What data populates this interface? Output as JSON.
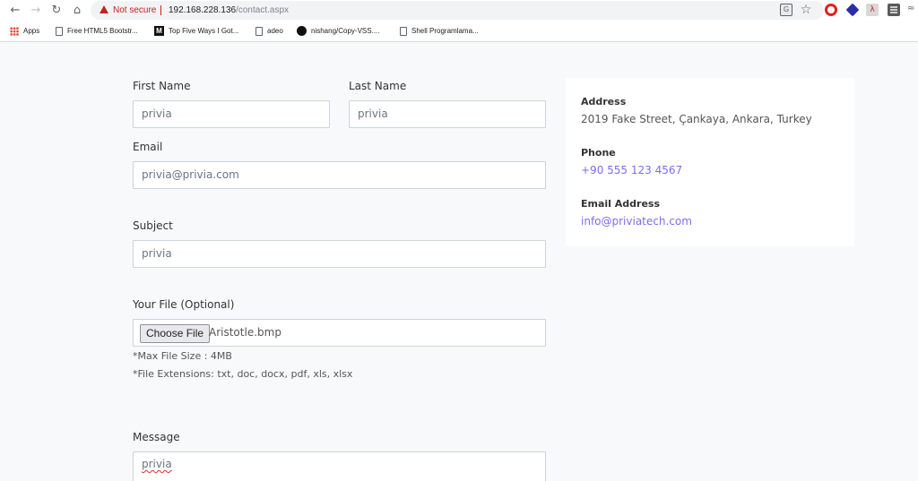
{
  "browser": {
    "security_label": "Not secure",
    "url_host": "192.168.228.136",
    "url_path": "/contact.aspx",
    "bookmarks": [
      {
        "label": "Apps"
      },
      {
        "label": "Free HTML5 Bootstr..."
      },
      {
        "label": "Top Five Ways I Got..."
      },
      {
        "label": "adeo"
      },
      {
        "label": "nishang/Copy-VSS...."
      },
      {
        "label": "Shell Programlama..."
      }
    ]
  },
  "form": {
    "first_name": {
      "label": "First Name",
      "value": "privia"
    },
    "last_name": {
      "label": "Last Name",
      "value": "privia"
    },
    "email": {
      "label": "Email",
      "value": "privia@privia.com"
    },
    "subject": {
      "label": "Subject",
      "value": "privia"
    },
    "file": {
      "label": "Your File (Optional)",
      "button": "Choose File",
      "file_name": "Aristotle.bmp",
      "max_size": "*Max File Size : 4MB",
      "extensions": "*File Extensions: txt, doc, docx, pdf, xls, xlsx"
    },
    "message": {
      "label": "Message",
      "value": "privia"
    }
  },
  "contact_info": {
    "address": {
      "heading": "Address",
      "value": "2019 Fake Street, Çankaya, Ankara, Turkey"
    },
    "phone": {
      "heading": "Phone",
      "value": "+90 555 123 4567"
    },
    "email": {
      "heading": "Email Address",
      "value": "info@priviatech.com"
    }
  },
  "colors": {
    "link": "#7b6ff0",
    "warning": "#c5221f"
  }
}
